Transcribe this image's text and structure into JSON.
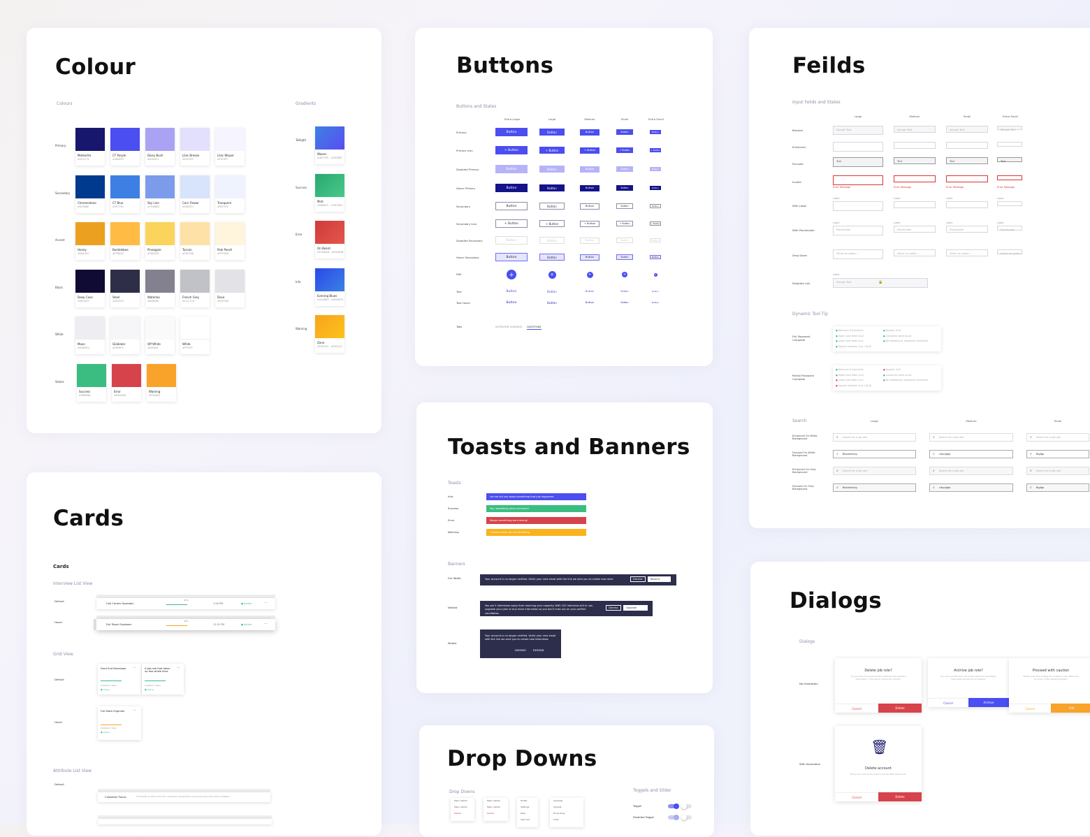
{
  "colour": {
    "title": "Colour",
    "colours_label": "Colours",
    "gradients_label": "Gradients",
    "rows": [
      {
        "label": "Primary",
        "swatches": [
          {
            "name": "Meteorite",
            "hex": "#1E1C74",
            "color": "#17176e"
          },
          {
            "name": "CT Purple",
            "hex": "#4B4EF0",
            "color": "#4b4ef0"
          },
          {
            "name": "Daisy Bush",
            "hex": "#A9A0F2",
            "color": "#aaa3f4"
          },
          {
            "name": "Lilac Breeze",
            "hex": "#E2E0FF",
            "color": "#e3e0fd"
          },
          {
            "name": "Lilac Wisper",
            "hex": "#F5F4FF",
            "color": "#f5f4ff"
          }
        ]
      },
      {
        "label": "Secondary",
        "swatches": [
          {
            "name": "Chromestone",
            "hex": "#00388E",
            "color": "#003a8f"
          },
          {
            "name": "CT Blue",
            "hex": "#3E7FE3",
            "color": "#3e7fe3"
          },
          {
            "name": "Sky Line",
            "hex": "#7A9BEB",
            "color": "#7c9ceb"
          },
          {
            "name": "Corn Flower",
            "hex": "#D6E2FC",
            "color": "#d8e3fc"
          },
          {
            "name": "Tranquere",
            "hex": "#EEF3FE",
            "color": "#eef3fe"
          }
        ]
      },
      {
        "label": "Accent",
        "swatches": [
          {
            "name": "Honey",
            "hex": "#EBA320",
            "color": "#eba11f"
          },
          {
            "name": "Bumblebee",
            "hex": "#FFB845",
            "color": "#ffbb44"
          },
          {
            "name": "Pineapple",
            "hex": "#FBD55E",
            "color": "#fbd45c"
          },
          {
            "name": "Tuscan",
            "hex": "#FEE3A8",
            "color": "#fee1a6"
          },
          {
            "name": "Pale Peach",
            "hex": "#FFF5DE",
            "color": "#fff4dc"
          }
        ]
      },
      {
        "label": "Black",
        "swatches": [
          {
            "name": "Deep Cove",
            "hex": "#0E0A33",
            "color": "#0f0b34"
          },
          {
            "name": "Steel",
            "hex": "#2E2E47",
            "color": "#2e2e48"
          },
          {
            "name": "Waterloo",
            "hex": "#83808E",
            "color": "#84818f"
          },
          {
            "name": "French Grey",
            "hex": "#C1C1C8",
            "color": "#c1c1c8"
          },
          {
            "name": "Dove",
            "hex": "#E3E3E8",
            "color": "#e2e2e7"
          }
        ]
      },
      {
        "label": "White",
        "swatches": [
          {
            "name": "Moon",
            "hex": "#EDEDF2",
            "color": "#ededf2"
          },
          {
            "name": "Gladiator",
            "hex": "#F6F6F9",
            "color": "#f6f6f9"
          },
          {
            "name": "Off White",
            "hex": "#FAFAFA",
            "color": "#fafafa"
          },
          {
            "name": "White",
            "hex": "#FFFFFF",
            "color": "#ffffff"
          }
        ]
      },
      {
        "label": "States",
        "swatches": [
          {
            "name": "Success",
            "hex": "#3BBD82",
            "color": "#3bbd82"
          },
          {
            "name": "Error",
            "hex": "#D6434B",
            "color": "#d6434b"
          },
          {
            "name": "Warning",
            "hex": "#F5A623",
            "color": "#f9a32a"
          }
        ]
      }
    ],
    "gradients": [
      {
        "label": "Twilight",
        "name": "Waves",
        "hex": "#4B7FE0 - #4E4BEF",
        "from": "#3b82e4",
        "to": "#5b4cf0"
      },
      {
        "label": "Success",
        "name": "Mint",
        "hex": "#2BB67F - #3ECB91",
        "from": "#2aa870",
        "to": "#48c98a"
      },
      {
        "label": "Error",
        "name": "On Board",
        "hex": "#D34B4B - #E54B4B",
        "from": "#d23a3a",
        "to": "#e2574c"
      },
      {
        "label": "Info",
        "name": "Evening Blues",
        "hex": "#2A4BE0 - #4D4DF0",
        "from": "#2c48e8",
        "to": "#3a82e6"
      },
      {
        "label": "Warning",
        "name": "Zone",
        "hex": "#F9A325 - #FEC012",
        "from": "#f6a41e",
        "to": "#fec21a"
      }
    ]
  },
  "buttons": {
    "title": "Buttons",
    "section_label": "Buttons and States",
    "columns": [
      "Extra Large",
      "Large",
      "Medium",
      "Small",
      "Extra Small"
    ],
    "rows": [
      "Primary",
      "Primary Icon",
      "Disabled Primary",
      "Hover Primary",
      "Secondary",
      "Secondary Icon",
      "Disabled Secondary",
      "Hover Secondary",
      "FAB",
      "Text",
      "Text Hover",
      "Tabs"
    ],
    "button_label": "Button",
    "icon_button_label": "+ Button",
    "fab_label": "+",
    "tabs": [
      "INTERVIEW LEARNING",
      "QUESTIONS"
    ]
  },
  "fields": {
    "title": "Feilds",
    "section_label": "Input Feilds and States",
    "columns": [
      "Large",
      "Medium",
      "Small",
      "Extra Small"
    ],
    "rows": [
      "Blocked",
      "Enhanced",
      "Focused",
      "Invalid",
      "With Label",
      "With Placeholder",
      "Drop Down",
      "Disabled Link"
    ],
    "placeholder_text": "Sample Text",
    "focused_text": "Text",
    "error_text": "Error Message",
    "label_text": "Label",
    "placeholder_label": "Placeholder",
    "dropdown_text": "Select an option",
    "tooltip_label": "Dynamic Tool Tip",
    "tooltip_rows": [
      "Full Password Complete",
      "Partial Password Complete"
    ],
    "tooltip_items": [
      "Minimum 8 characters",
      "Upper case letter (A-Z)",
      "Lower case letter (a-z)",
      "Special character (e.g. !,@,#)",
      "Number (0-9)",
      "Cannot be same as old",
      "No repeating or sequential characters"
    ],
    "search_label": "Search",
    "search_columns": [
      "Large",
      "Medium",
      "Small"
    ],
    "search_rows": [
      "Enhanced On White Background",
      "Focused On White Background",
      "Enhanced On Grey Background",
      "Focused On Grey Background"
    ],
    "search_placeholder": "Search for a job role",
    "search_focused_values": [
      "Bidcatching",
      "cityngfgo",
      "Bigfgo"
    ]
  },
  "toasts": {
    "title": "Toasts and Banners",
    "toasts_label": "Toasts",
    "items": [
      {
        "label": "Info",
        "text": "Let me tell you about something that just happened",
        "color": "#4b4ef0"
      },
      {
        "label": "Success",
        "text": "Yay, something went successful",
        "color": "#3bbd82"
      },
      {
        "label": "Error",
        "text": "Woops something went wrong!",
        "color": "#d6434b"
      },
      {
        "label": "Warning",
        "text": "I need to warn you of something",
        "color": "#fbb21c"
      }
    ],
    "banners_label": "Banners",
    "banners": [
      {
        "label": "Full Width",
        "text": "Your account is no longer verified. Verify your new email with the link we sent you to create new roles",
        "dismiss": "Dismiss",
        "action": "Resend"
      },
      {
        "label": "Nested",
        "text": "You are 5 interviews away from reaching your capacity. With 120 interview still in use, upgrade your plan or buy more interviews so you don't miss out on your perfect candidates.",
        "dismiss": "Dismiss",
        "action": "Upgrade"
      },
      {
        "label": "Mobile",
        "text": "Your account is no longer verified. Verify your new email with the link we sent you to create new interviews",
        "dismiss": "DISMISS",
        "action": "RESEND"
      }
    ]
  },
  "cards": {
    "title": "Cards",
    "section_label": "Cards",
    "list_view_label": "Interview List View",
    "grid_view_label": "Grid View",
    "attribute_label": "Attribute List View",
    "row_labels": [
      "Default",
      "Hover"
    ],
    "list_items": [
      {
        "role": "Call Centre Operator",
        "score": "60%",
        "date": "1:26 PM",
        "status": "Active"
      },
      {
        "role": "Full Stack Engineer",
        "score": "40%",
        "date": "12:31 PM",
        "status": "Active"
      }
    ],
    "grid_items": [
      "Front End Developer",
      "A Job role that takes up two whole lines",
      "Full Stack Engineer"
    ],
    "grid_meta": "Created 2 days",
    "grid_status": "Active",
    "attribute_row": {
      "name": "Customer Focus",
      "desc": "The ability to think from the customers' perspective and proactively solve their problems"
    },
    "default_label": "Default"
  },
  "dialogs": {
    "title": "Dialogs",
    "section_label": "Dialogs",
    "row_labels": [
      "No Illustration",
      "With Illustration"
    ],
    "items": [
      {
        "title": "Delete job role?",
        "body": "You are about to permanently delete all the selected information. This action cannot be undone.",
        "cancel": "Cancel",
        "primary": "Delete",
        "color": "#d6434b"
      },
      {
        "title": "Archive job role?",
        "body": "You can't publish this role to the selected candidates, interviews will still be accessible.",
        "cancel": "Cancel",
        "primary": "Archive",
        "color": "#4b4ef0"
      },
      {
        "title": "Proceed with caution",
        "body": "Please note that editing this question may affect the accuracy of the existing system.",
        "cancel": "Cancel",
        "primary": "Edit",
        "color": "#f9a32a"
      },
      {
        "title": "Delete account",
        "body": "This action cannot be undone and all data will be lost.",
        "cancel": "Cancel",
        "primary": "Delete",
        "color": "#d6434b"
      }
    ]
  },
  "dropdowns": {
    "title": "Drop Downs",
    "section_label": "Drop Downs",
    "toggles_label": "Toggels and Slider",
    "toggle_rows": [
      "Toggel",
      "Disabled Toggel"
    ],
    "menu_items": [
      "Menu Option",
      "Menu Option",
      "Delete"
    ],
    "menu2_items": [
      "Menu Option",
      "Menu Option",
      "Delete"
    ],
    "menu3_items": [
      "Profile",
      "Settings",
      "Help",
      "Sign Out"
    ],
    "menu4_items": [
      "Australia",
      "Canada",
      "Hong Kong",
      "India"
    ]
  }
}
